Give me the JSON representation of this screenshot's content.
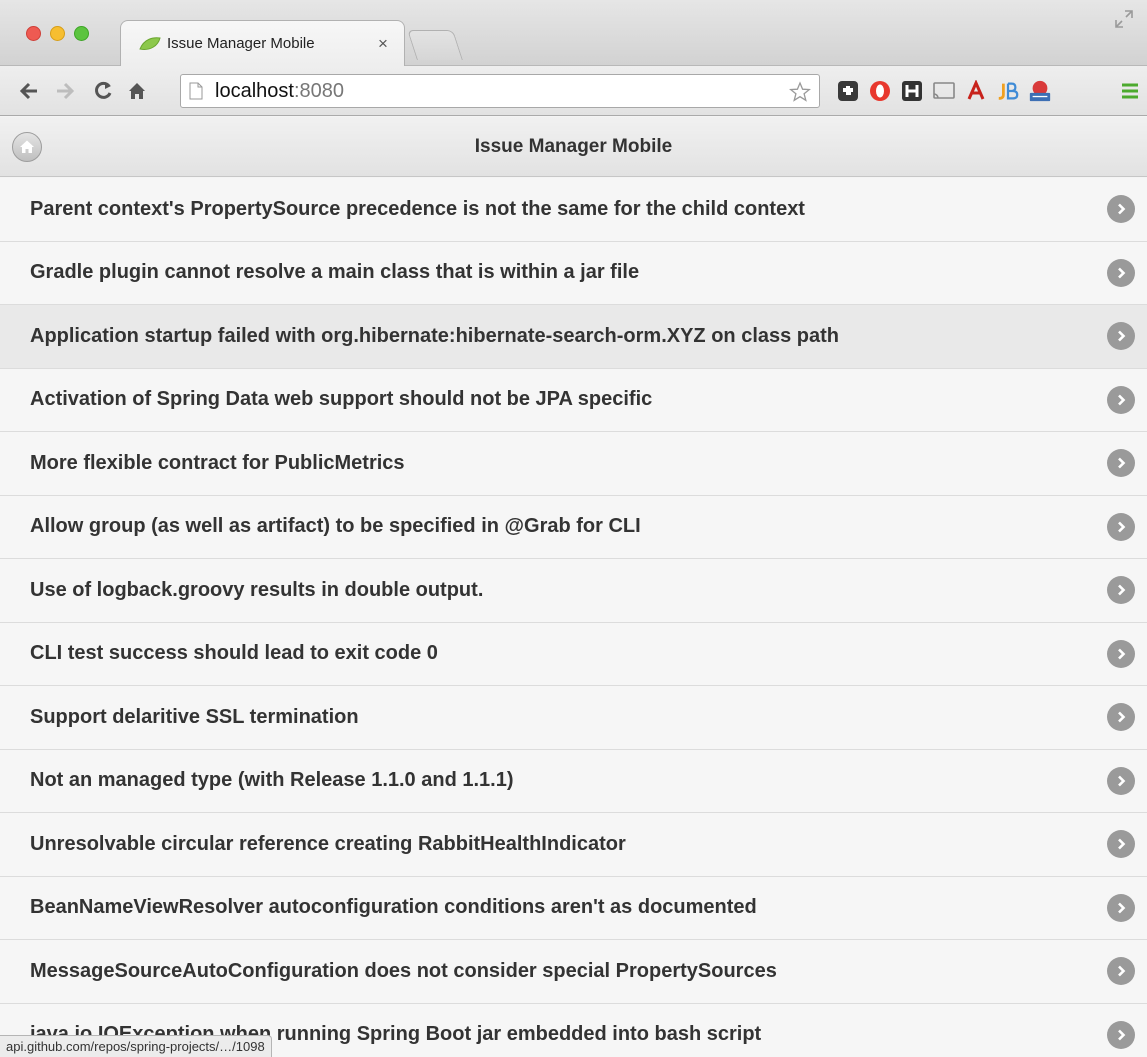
{
  "browser": {
    "tab_title": "Issue Manager Mobile",
    "tab_close": "×",
    "url_host": "localhost",
    "url_port": ":8080",
    "status_url": "api.github.com/repos/spring-projects/…/1098",
    "extensions": [
      "puzzle-icon",
      "opera-icon",
      "hn-icon",
      "cast-icon",
      "acrobat-icon",
      "jb-icon",
      "ipv4-icon",
      "menu-icon"
    ]
  },
  "header": {
    "title": "Issue Manager Mobile"
  },
  "issues": [
    "Parent context's PropertySource precedence is not the same for the child context",
    "Gradle plugin cannot resolve a main class that is within a jar file",
    "Application startup failed with org.hibernate:hibernate-search-orm.XYZ on class path",
    "Activation of Spring Data web support should not be JPA specific",
    "More flexible contract for PublicMetrics",
    "Allow group (as well as artifact) to be specified in @Grab for CLI",
    "Use of logback.groovy results in double output.",
    "CLI test success should lead to exit code 0",
    "Support delaritive SSL termination",
    "Not an managed type (with Release 1.1.0 and 1.1.1)",
    "Unresolvable circular reference creating RabbitHealthIndicator",
    "BeanNameViewResolver autoconfiguration conditions aren't as documented",
    "MessageSourceAutoConfiguration does not consider special PropertySources",
    "java.io.IOException when running Spring Boot jar embedded into bash script"
  ],
  "active_index": 2,
  "colors": {
    "chevron": "#9a9a9a",
    "row_bg": "#f6f6f6",
    "row_active_bg": "#e9e9e9"
  }
}
